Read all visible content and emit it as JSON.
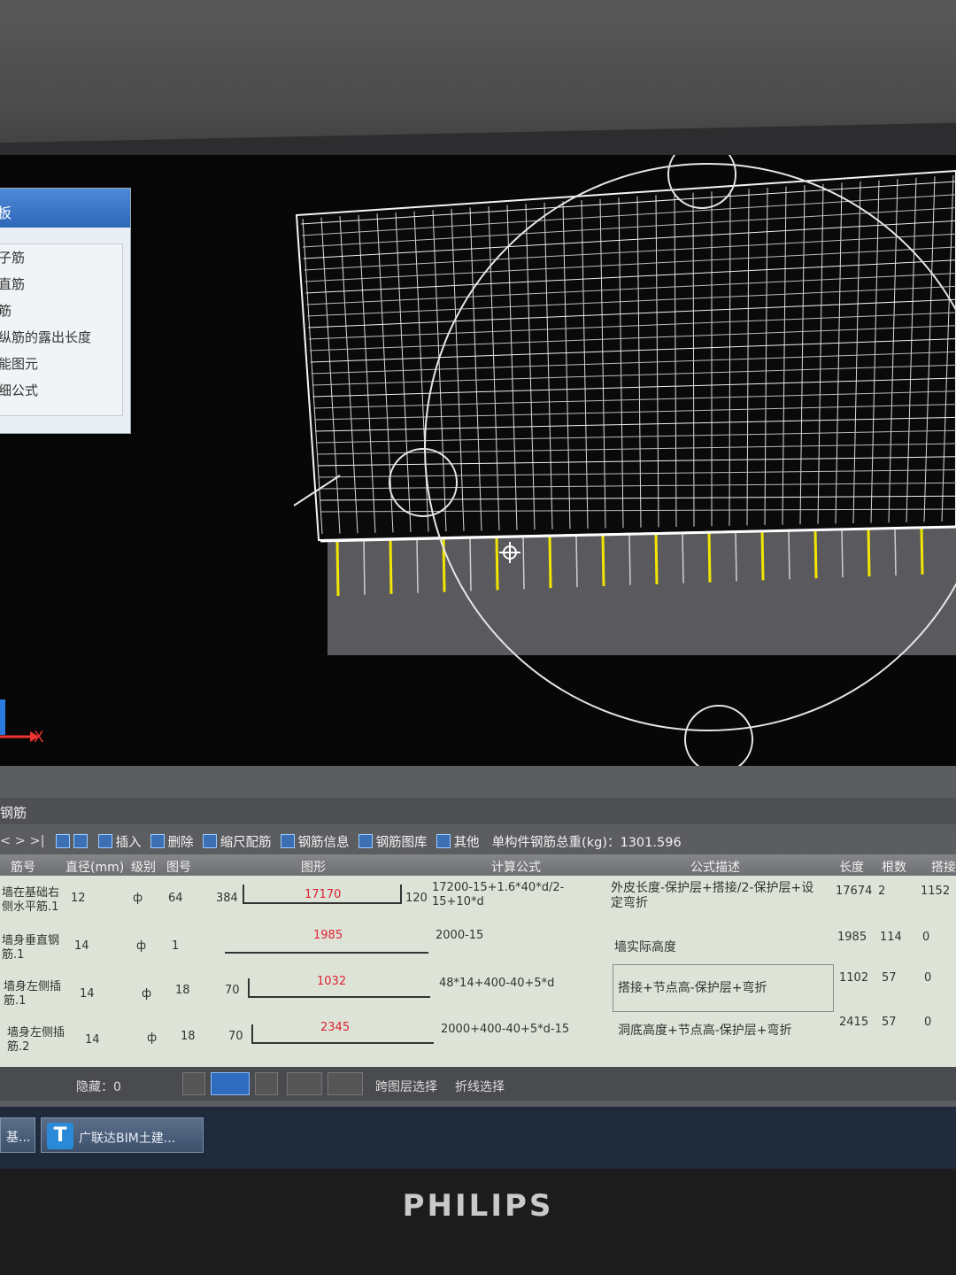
{
  "context_panel": {
    "title": "板",
    "items": [
      "子筋",
      "直筋",
      "筋",
      "纵筋的露出长度",
      "能图元",
      "细公式"
    ]
  },
  "axis": {
    "x_label": "X"
  },
  "panel": {
    "title": "钢筋",
    "toolbar": {
      "nav": "< > >|",
      "insert": "插入",
      "delete": "删除",
      "scale_rebar": "缩尺配筋",
      "rebar_info": "钢筋信息",
      "rebar_library": "钢筋图库",
      "other": "其他",
      "total_weight": "单构件钢筋总重(kg)：1301.596"
    },
    "columns": {
      "name": "筋号",
      "diameter": "直径(mm)",
      "grade": "级别",
      "shape_no": "图号",
      "shape": "图形",
      "formula": "计算公式",
      "formula_desc": "公式描述",
      "length": "长度",
      "count": "根数",
      "lap": "搭接"
    },
    "rows": [
      {
        "name": "墙在基础右侧水平筋.1",
        "diameter": "12",
        "grade": "ф",
        "shape_no": "64",
        "left": "384",
        "mid": "17170",
        "right": "120",
        "formula": "17200-15+1.6*40*d/2-15+10*d",
        "desc": "外皮长度-保护层+搭接/2-保护层+设定弯折",
        "length": "17674",
        "count": "2",
        "lap": "1152"
      },
      {
        "name": "墙身垂直钢筋.1",
        "diameter": "14",
        "grade": "ф",
        "shape_no": "1",
        "left": "",
        "mid": "1985",
        "right": "",
        "formula": "2000-15",
        "desc": "墙实际高度",
        "length": "1985",
        "count": "114",
        "lap": "0"
      },
      {
        "name": "墙身左侧插筋.1",
        "diameter": "14",
        "grade": "ф",
        "shape_no": "18",
        "left": "70",
        "mid": "1032",
        "right": "",
        "formula": "48*14+400-40+5*d",
        "desc": "搭接+节点高-保护层+弯折",
        "length": "1102",
        "count": "57",
        "lap": "0"
      },
      {
        "name": "墙身左侧插筋.2",
        "diameter": "14",
        "grade": "ф",
        "shape_no": "18",
        "left": "70",
        "mid": "2345",
        "right": "",
        "formula": "2000+400-40+5*d-15",
        "desc": "洞底高度+节点高-保护层+弯折",
        "length": "2415",
        "count": "57",
        "lap": "0"
      }
    ]
  },
  "statusbar": {
    "hidden": "隐藏：0",
    "cross_layer": "跨图层选择",
    "polyline": "折线选择"
  },
  "taskbar": {
    "items": [
      "基...",
      "广联达BIM土建..."
    ],
    "app_icon_letter": "T"
  },
  "monitor": {
    "brand": "PHILIPS"
  }
}
